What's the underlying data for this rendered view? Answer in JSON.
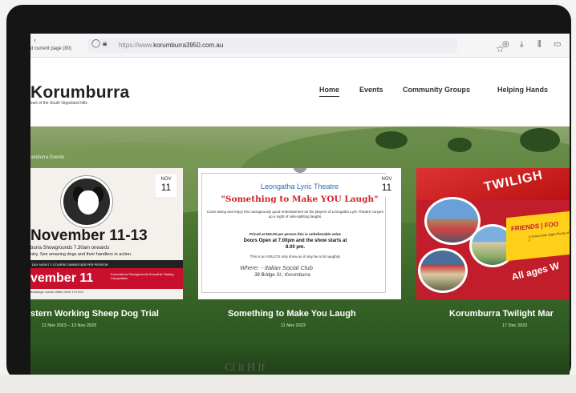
{
  "browser": {
    "tab_hint": "d current page (80)",
    "url_prefix": "https://www.",
    "url_host": "korumburra3950.com.au",
    "icons": [
      "back-icon",
      "forward-icon",
      "shield-icon",
      "lock-icon",
      "star-icon",
      "pocket-icon",
      "download-icon",
      "library-icon",
      "sidebar-icon"
    ]
  },
  "site": {
    "logo": "Korumburra",
    "tagline": "eart of the South Gippsland hills",
    "nav": [
      "Home",
      "Events",
      "Community Groups",
      "Helping Hands"
    ],
    "active_nav": "Home"
  },
  "hero": {
    "section_label": "umburra Events",
    "cards": [
      {
        "badge_month": "NOV",
        "badge_day": "11",
        "poster": {
          "heading": "November 11-13",
          "line1": "burra Showgrounds 7.30am onwards",
          "line2": "ntry. See amazing dogs and their handlers in action.",
          "bar": "DAY NIGHT 2 COURSE DINNER $25 PER PERSON",
          "red_big": "vember 11",
          "red_small": "Korumburra Showgrounds Smoothie Tasting Competition",
          "foot": "Bookings Louise Walls 0409 173 904"
        },
        "title": "stern Working Sheep Dog Trial",
        "date": "11 Nov 2023 – 13 Nov 2023"
      },
      {
        "badge_month": "NOV",
        "badge_day": "11",
        "poster": {
          "org": "Leongatha Lyric Theatre",
          "quote": "\"Something to Make YOU Laugh\"",
          "intro": "Come along and enjoy this outrageously good entertainment as the players of Leongatha Lyric Theatre conjure up a night of side-splitting laughs.",
          "price": "Priced at $25.00 per person this is unbelievable value",
          "doors1": "Doors Open at 7.00pm and the show starts at",
          "doors2": "8.00 pm.",
          "adults": "This is an ADULTS only show as it may be a bit naughty!",
          "where": "Where: - Italian Social Club",
          "address": "38 Bridge St., Korumburra"
        },
        "title": "Something to Make You Laugh",
        "date": "11 Nov 2023"
      },
      {
        "poster": {
          "twilight": "TWILIGH",
          "friends": "FRIENDS | FOO",
          "small": "A Great Date Night Plenty of F",
          "all_ages": "All ages W"
        },
        "title": "Korumburra Twilight Mar",
        "date": "17 Dec 2023"
      }
    ]
  },
  "below_text": "Cl   it   H   lf"
}
